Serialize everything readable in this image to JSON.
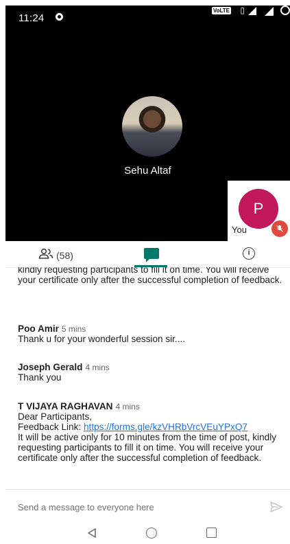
{
  "status_bar": {
    "time": "11:24",
    "volte": "VoLTE",
    "network": "4G"
  },
  "call": {
    "speaker_name": "Sehu Altaf",
    "self_initial": "P",
    "self_label": "You"
  },
  "tabs": {
    "people_count": "(58)"
  },
  "messages": {
    "truncated_text": "kindly requesting participants to fill it on time. You will receive your certificate only after the successful completion of feedback.",
    "m1": {
      "sender": "Poo Amir",
      "time": "5 mins",
      "text": "Thank u for your wonderful session sir...."
    },
    "m2": {
      "sender": "Joseph Gerald",
      "time": "4 mins",
      "text": "Thank you"
    },
    "m3": {
      "sender": "T VIJAYA RAGHAVAN",
      "time": "4 mins",
      "line1": "Dear Participants,",
      "link_label": "Feedback Link:",
      "link_url": "https://forms.gle/kzVHRbVrcVEuYPxQ7",
      "text": "It will be active only for 10 minutes from the time of post, kindly requesting participants to fill it on time. You will receive your certificate only after the successful completion of feedback."
    }
  },
  "composer": {
    "placeholder": "Send a message to everyone here"
  },
  "colors": {
    "accent": "#00796b",
    "self_avatar": "#c2185b",
    "mic_off": "#e04a3f",
    "link": "#1a73e8"
  },
  "icons": {
    "people": "people-icon",
    "chat": "chat-icon",
    "info": "info-icon",
    "send": "send-icon",
    "mic_off": "mic-off-icon"
  }
}
